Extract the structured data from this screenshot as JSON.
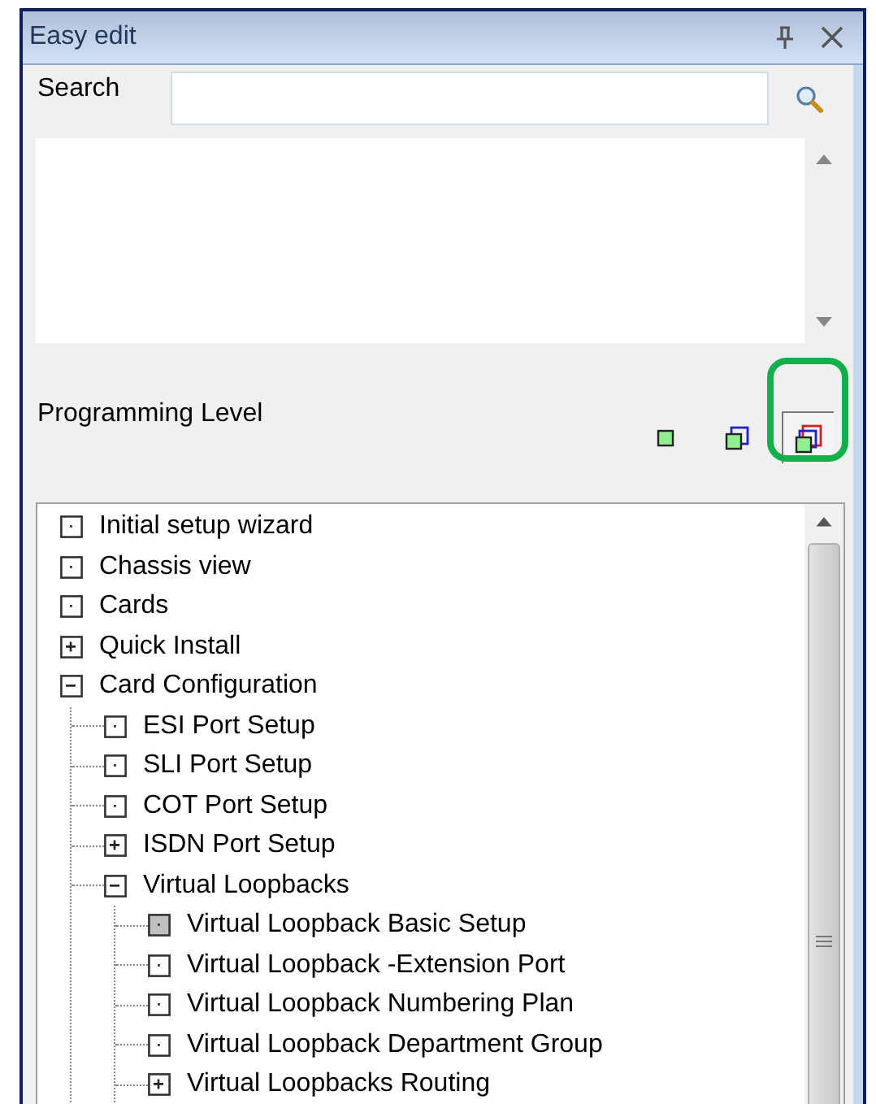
{
  "window": {
    "title": "Easy edit"
  },
  "search": {
    "label": "Search"
  },
  "programming_level": {
    "label": "Programming Level",
    "levels": [
      {
        "kind": "single",
        "selected": false
      },
      {
        "kind": "double",
        "selected": false
      },
      {
        "kind": "triple",
        "selected": true
      }
    ]
  },
  "tree": [
    {
      "label": "Initial setup wizard",
      "kind": "leaf",
      "selected": false
    },
    {
      "label": "Chassis view",
      "kind": "leaf",
      "selected": false
    },
    {
      "label": "Cards",
      "kind": "leaf",
      "selected": false
    },
    {
      "label": "Quick Install",
      "kind": "folder",
      "expanded": false,
      "selected": false
    },
    {
      "label": "Card Configuration",
      "kind": "folder",
      "expanded": true,
      "selected": false,
      "children": [
        {
          "label": "ESI Port Setup",
          "kind": "leaf",
          "selected": false
        },
        {
          "label": "SLI Port Setup",
          "kind": "leaf",
          "selected": false
        },
        {
          "label": "COT Port Setup",
          "kind": "leaf",
          "selected": false
        },
        {
          "label": "ISDN Port Setup",
          "kind": "folder",
          "expanded": false,
          "selected": false
        },
        {
          "label": "Virtual Loopbacks",
          "kind": "folder",
          "expanded": true,
          "selected": false,
          "children": [
            {
              "label": "Virtual Loopback Basic Setup",
              "kind": "leaf",
              "selected": true
            },
            {
              "label": "Virtual Loopback -Extension Port",
              "kind": "leaf",
              "selected": false
            },
            {
              "label": "Virtual Loopback Numbering Plan",
              "kind": "leaf",
              "selected": false
            },
            {
              "label": "Virtual Loopback Department Group",
              "kind": "leaf",
              "selected": false
            },
            {
              "label": "Virtual Loopbacks Routing",
              "kind": "folder",
              "expanded": false,
              "selected": false
            }
          ]
        }
      ]
    }
  ]
}
